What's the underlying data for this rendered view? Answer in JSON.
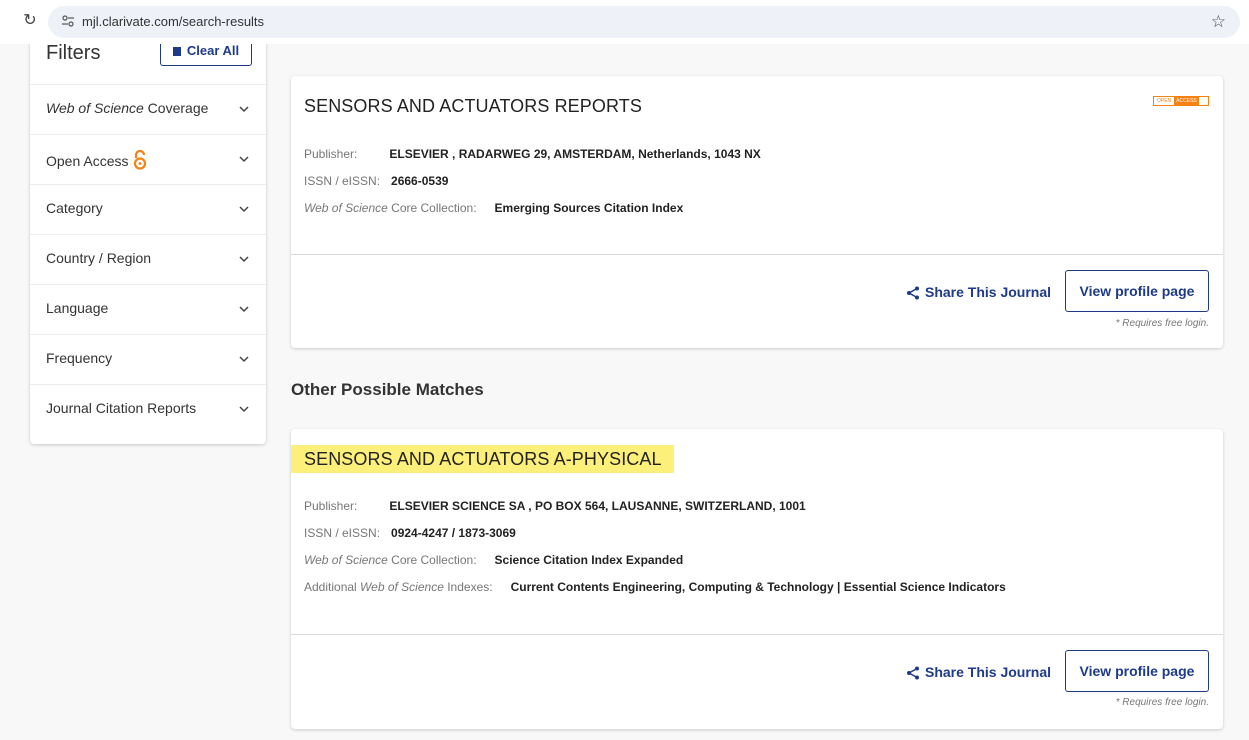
{
  "browser": {
    "url": "mjl.clarivate.com/search-results"
  },
  "filters": {
    "title": "Filters",
    "clear_all": "Clear All",
    "items": [
      {
        "label_italic": "Web of Science",
        "label_rest": " Coverage"
      },
      {
        "label_italic": "",
        "label_rest": "Open Access"
      },
      {
        "label_italic": "",
        "label_rest": "Category"
      },
      {
        "label_italic": "",
        "label_rest": "Country / Region"
      },
      {
        "label_italic": "",
        "label_rest": "Language"
      },
      {
        "label_italic": "",
        "label_rest": "Frequency"
      },
      {
        "label_italic": "",
        "label_rest": "Journal Citation Reports"
      }
    ]
  },
  "colors": {
    "brand_blue": "#1e3a8a",
    "open_access_orange": "#f68212",
    "highlight_yellow": "#fdf07a"
  },
  "result": {
    "title": "SENSORS AND ACTUATORS REPORTS",
    "badge_left": "OPEN",
    "badge_right": "ACCESS",
    "publisher_label": "Publisher:",
    "publisher": "ELSEVIER , RADARWEG 29, AMSTERDAM, Netherlands, 1043 NX",
    "issn_label": "ISSN / eISSN:",
    "issn": "2666-0539",
    "collection_label_italic": "Web of Science",
    "collection_label_rest": " Core Collection:",
    "collection": "Emerging Sources Citation Index",
    "share": "Share This Journal",
    "view": "View profile page",
    "requires": "* Requires free login."
  },
  "other_heading": "Other Possible Matches",
  "match": {
    "title": "SENSORS AND ACTUATORS A-PHYSICAL",
    "publisher_label": "Publisher:",
    "publisher": "ELSEVIER SCIENCE SA , PO BOX 564, LAUSANNE, SWITZERLAND, 1001",
    "issn_label": "ISSN / eISSN:",
    "issn": "0924-4247 / 1873-3069",
    "collection_label_italic": "Web of Science",
    "collection_label_rest": " Core Collection:",
    "collection": "Science Citation Index Expanded",
    "additional_label_a": "Additional ",
    "additional_label_italic": "Web of Science",
    "additional_label_b": " Indexes:",
    "additional": "Current Contents Engineering, Computing & Technology | Essential Science Indicators",
    "share": "Share This Journal",
    "view": "View profile page",
    "requires": "* Requires free login."
  }
}
